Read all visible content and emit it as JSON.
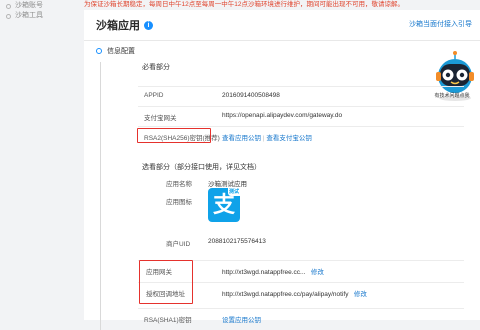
{
  "sidebar": {
    "items": [
      {
        "label": "沙箱账号"
      },
      {
        "label": "沙箱工具"
      }
    ]
  },
  "notice": "为保证沙箱长期稳定，每周日中午12点至每周一中午12点沙箱环境进行维护，期间可能出现不可用，敬请谅解。",
  "header": {
    "title": "沙箱应用",
    "info_icon": "i",
    "guide_link": "沙箱当面付接入引导"
  },
  "info_section": {
    "title": "信息配置",
    "required_group": {
      "title": "必看部分",
      "rows": [
        {
          "label": "APPID",
          "value": "2016091400508498"
        },
        {
          "label": "支付宝网关",
          "value": "https://openapi.alipaydev.com/gateway.do"
        },
        {
          "label": "RSA2(SHA256)密钥(推荐)",
          "link1": "查看应用公钥",
          "sep": "|",
          "link2": "查看支付宝公钥"
        }
      ]
    },
    "optional_group": {
      "title": "选看部分（部分接口使用，详见文档）",
      "app_name_label": "应用名称",
      "app_name_value": "沙箱测试应用",
      "app_icon_label": "应用图标",
      "icon_glyph": "支",
      "icon_badge": "测试",
      "merchant_label": "商户UID",
      "merchant_value": "2088102175576413",
      "gateway_label": "应用网关",
      "gateway_value": "http://xt3wgd.natappfree.cc...",
      "gateway_action": "修改",
      "callback_label": "授权回调地址",
      "callback_value": "http://xt3wgd.natappfree.cc/pay/alipay/notify",
      "callback_action": "修改",
      "rsa1_label": "RSA(SHA1)密钥",
      "rsa1_action": "设置应用公钥"
    }
  },
  "mascot": {
    "caption": "有技术问题点我",
    "icon": "robot-assistant-icon"
  },
  "colors": {
    "accent": "#1890ff",
    "link": "#1677cc",
    "highlight_box": "#e5322d",
    "notice": "#e0462f",
    "app_icon": "#0fa2e9"
  }
}
